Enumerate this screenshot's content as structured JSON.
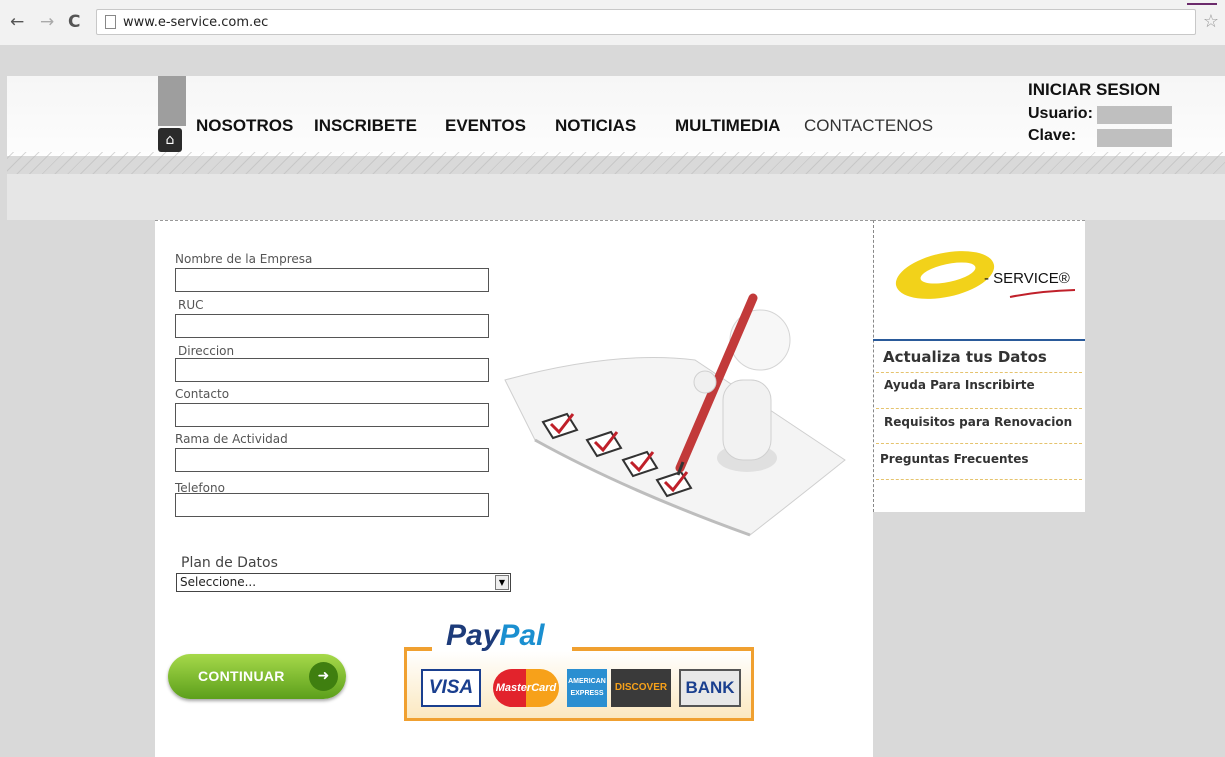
{
  "browser": {
    "url": "www.e-service.com.ec",
    "back_glyph": "←",
    "forward_glyph": "→",
    "reload_glyph": "C",
    "star_glyph": "☆"
  },
  "nav": {
    "items": [
      "NOSOTROS",
      "INSCRIBETE",
      "EVENTOS",
      "NOTICIAS",
      "MULTIMEDIA",
      "CONTACTENOS"
    ]
  },
  "login": {
    "title": "INICIAR SESION",
    "user_label": "Usuario:",
    "pass_label": "Clave:"
  },
  "form": {
    "fields": [
      "Nombre de la Empresa",
      "RUC",
      "Direccion",
      "Contacto",
      "Rama de Actividad",
      "Telefono"
    ],
    "plan_label": "Plan de Datos",
    "plan_value": "Seleccione...",
    "submit_label": "CONTINUAR"
  },
  "payment": {
    "paypal_text_1": "Pay",
    "paypal_text_2": "Pal",
    "cards": [
      "VISA",
      "MasterCard",
      "AMERICAN EXPRESS",
      "DISCOVER",
      "BANK"
    ]
  },
  "sidebar": {
    "brand": "- SERVICE®",
    "title": "Actualiza tus Datos",
    "links": [
      "Ayuda Para Inscribirte",
      "Requisitos para Renovacion",
      "Preguntas Frecuentes"
    ]
  },
  "colors": {
    "accent_green": "#5c9f1b",
    "paypal_orange": "#f0a030",
    "brand_yellow": "#f2d21a"
  }
}
